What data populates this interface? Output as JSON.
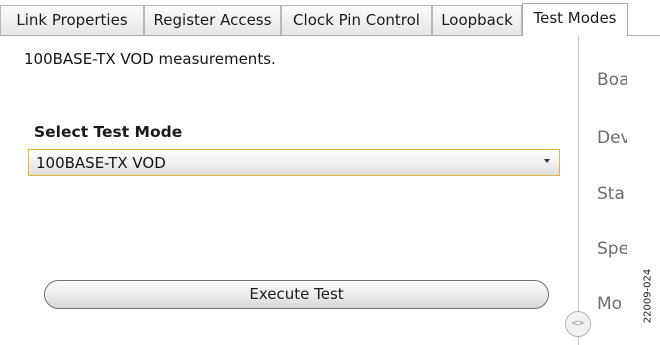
{
  "tabs": [
    {
      "label": "Link Properties",
      "active": false
    },
    {
      "label": "Register Access",
      "active": false
    },
    {
      "label": "Clock Pin Control",
      "active": false
    },
    {
      "label": "Loopback",
      "active": false
    },
    {
      "label": "Test Modes",
      "active": true
    }
  ],
  "main": {
    "description": "100BASE-TX VOD measurements.",
    "select_label": "Select Test Mode",
    "select_value": "100BASE-TX VOD",
    "execute_label": "Execute Test"
  },
  "side_panel": {
    "labels": [
      "Boa",
      "Dev",
      "Sta",
      "Spe",
      "Mo"
    ],
    "toggle_icon": "collapse-expand-icon"
  },
  "figure_id": "22009-024",
  "colors": {
    "select_focus_border": "#e0b84a",
    "tab_border": "#b9b9b9",
    "side_label_text": "#6e6e6e"
  }
}
